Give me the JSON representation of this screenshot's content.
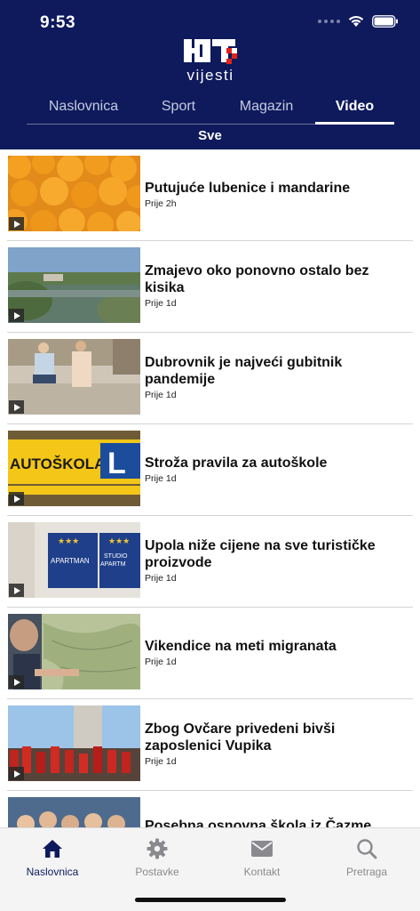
{
  "status_bar": {
    "time": "9:53"
  },
  "logo": {
    "word": "vijesti"
  },
  "tabs": [
    {
      "label": "Naslovnica",
      "active": false
    },
    {
      "label": "Sport",
      "active": false
    },
    {
      "label": "Magazin",
      "active": false
    },
    {
      "label": "Video",
      "active": true
    }
  ],
  "subfilter": "Sve",
  "articles": [
    {
      "title": "Putujuće lubenice i mandarine",
      "time": "Prije 2h"
    },
    {
      "title": "Zmajevo oko ponovno ostalo bez kisika",
      "time": "Prije 1d"
    },
    {
      "title": "Dubrovnik je najveći gubitnik pandemije",
      "time": "Prije 1d"
    },
    {
      "title": "Stroža pravila za autoškole",
      "time": "Prije 1d"
    },
    {
      "title": "Upola niže cijene na sve turističke proizvode",
      "time": "Prije 1d"
    },
    {
      "title": "Vikendice na meti migranata",
      "time": "Prije 1d"
    },
    {
      "title": "Zbog Ovčare privedeni bivši zaposlenici Vupika",
      "time": "Prije 1d"
    },
    {
      "title": "Posebna osnovna škola iz Čazme",
      "time": ""
    }
  ],
  "thumb_text": {
    "autoskola": "AUTOŠKOLA",
    "apartman": "APARTMAN",
    "studio": "STUDIO",
    "apartm": "APARTM"
  },
  "tabbar": [
    {
      "label": "Naslovnica",
      "icon": "home-icon",
      "active": true
    },
    {
      "label": "Postavke",
      "icon": "gear-icon",
      "active": false
    },
    {
      "label": "Kontakt",
      "icon": "mail-icon",
      "active": false
    },
    {
      "label": "Pretraga",
      "icon": "search-icon",
      "active": false
    }
  ],
  "colors": {
    "brand_navy": "#0e1a5c",
    "hrt_red": "#e2231a",
    "inactive_gray": "#8a8a8e"
  }
}
